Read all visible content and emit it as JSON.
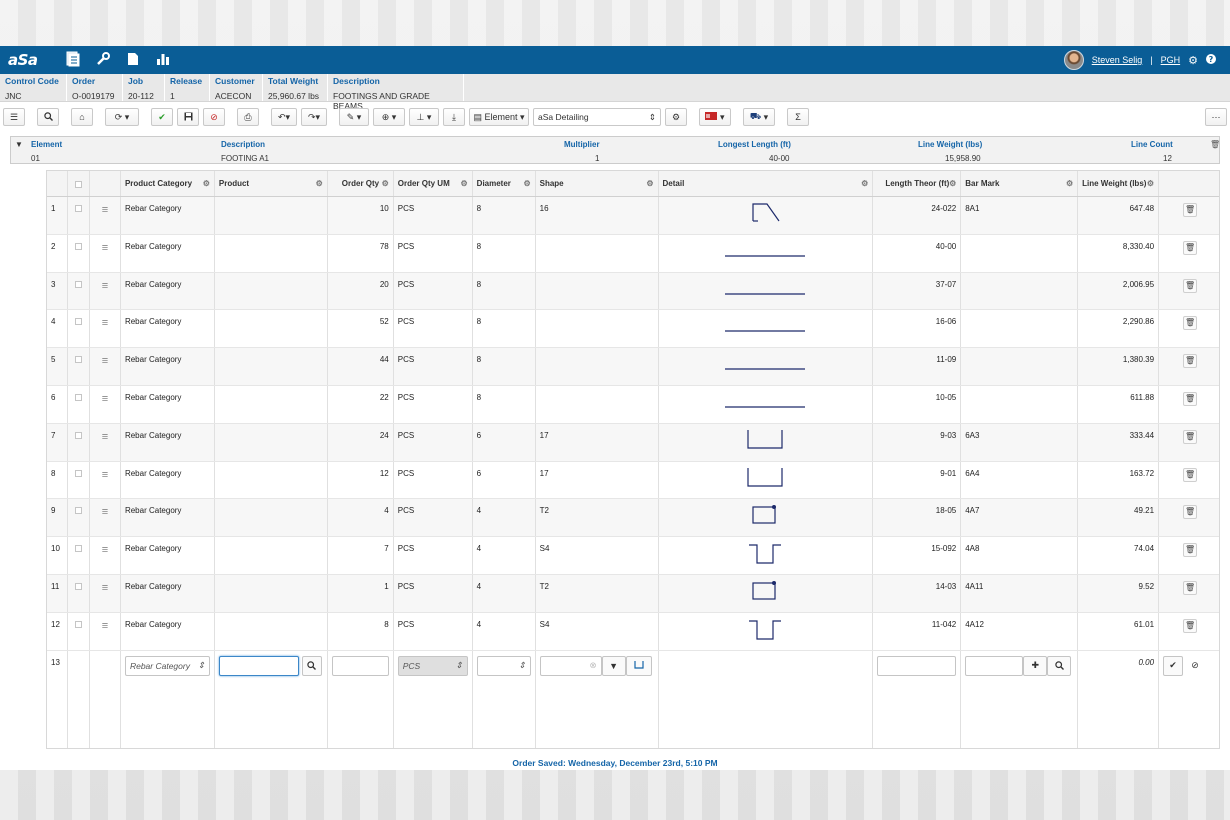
{
  "topbar": {
    "logo": "aSa",
    "user_name": "Steven Selig",
    "location": "PGH",
    "separator": "|"
  },
  "header": {
    "columns": [
      {
        "label": "Control Code",
        "value": "JNC"
      },
      {
        "label": "Order",
        "value": "O-0019179"
      },
      {
        "label": "Job",
        "value": "20-112"
      },
      {
        "label": "Release",
        "value": "1"
      },
      {
        "label": "Customer",
        "value": "ACECON"
      },
      {
        "label": "Total Weight",
        "value": "25,960.67 lbs"
      },
      {
        "label": "Description",
        "value": "FOOTINGS AND GRADE BEAMS"
      }
    ]
  },
  "toolbar": {
    "element_label": "Element",
    "detailing_select": "aSa Detailing",
    "sigma": "Σ"
  },
  "element": {
    "headers": {
      "element": "Element",
      "description": "Description",
      "multiplier": "Multiplier",
      "longest_length": "Longest Length (ft)",
      "line_weight": "Line Weight (lbs)",
      "line_count": "Line Count"
    },
    "values": {
      "element": "01",
      "description": "FOOTING A1",
      "multiplier": "1",
      "longest_length": "40-00",
      "line_weight": "15,958.90",
      "line_count": "12"
    }
  },
  "grid": {
    "columns": {
      "product_category": "Product Category",
      "product": "Product",
      "order_qty": "Order Qty",
      "order_qty_um": "Order Qty UM",
      "diameter": "Diameter",
      "shape": "Shape",
      "detail": "Detail",
      "length_theor": "Length Theor (ft)",
      "bar_mark": "Bar Mark",
      "line_weight": "Line Weight (lbs)"
    },
    "rows": [
      {
        "num": "1",
        "category": "Rebar Category",
        "product": "",
        "qty": "10",
        "um": "PCS",
        "dia": "8",
        "shape": "16",
        "detail": "hook",
        "length": "24-022",
        "mark": "8A1",
        "weight": "647.48"
      },
      {
        "num": "2",
        "category": "Rebar Category",
        "product": "",
        "qty": "78",
        "um": "PCS",
        "dia": "8",
        "shape": "",
        "detail": "straight",
        "length": "40-00",
        "mark": "",
        "weight": "8,330.40"
      },
      {
        "num": "3",
        "category": "Rebar Category",
        "product": "",
        "qty": "20",
        "um": "PCS",
        "dia": "8",
        "shape": "",
        "detail": "straight",
        "length": "37-07",
        "mark": "",
        "weight": "2,006.95"
      },
      {
        "num": "4",
        "category": "Rebar Category",
        "product": "",
        "qty": "52",
        "um": "PCS",
        "dia": "8",
        "shape": "",
        "detail": "straight",
        "length": "16-06",
        "mark": "",
        "weight": "2,290.86"
      },
      {
        "num": "5",
        "category": "Rebar Category",
        "product": "",
        "qty": "44",
        "um": "PCS",
        "dia": "8",
        "shape": "",
        "detail": "straight",
        "length": "11-09",
        "mark": "",
        "weight": "1,380.39"
      },
      {
        "num": "6",
        "category": "Rebar Category",
        "product": "",
        "qty": "22",
        "um": "PCS",
        "dia": "8",
        "shape": "",
        "detail": "straight",
        "length": "10-05",
        "mark": "",
        "weight": "611.88"
      },
      {
        "num": "7",
        "category": "Rebar Category",
        "product": "",
        "qty": "24",
        "um": "PCS",
        "dia": "6",
        "shape": "17",
        "detail": "u",
        "length": "9-03",
        "mark": "6A3",
        "weight": "333.44"
      },
      {
        "num": "8",
        "category": "Rebar Category",
        "product": "",
        "qty": "12",
        "um": "PCS",
        "dia": "6",
        "shape": "17",
        "detail": "u",
        "length": "9-01",
        "mark": "6A4",
        "weight": "163.72"
      },
      {
        "num": "9",
        "category": "Rebar Category",
        "product": "",
        "qty": "4",
        "um": "PCS",
        "dia": "4",
        "shape": "T2",
        "detail": "tie",
        "length": "18-05",
        "mark": "4A7",
        "weight": "49.21"
      },
      {
        "num": "10",
        "category": "Rebar Category",
        "product": "",
        "qty": "7",
        "um": "PCS",
        "dia": "4",
        "shape": "S4",
        "detail": "stirrup",
        "length": "15-092",
        "mark": "4A8",
        "weight": "74.04"
      },
      {
        "num": "11",
        "category": "Rebar Category",
        "product": "",
        "qty": "1",
        "um": "PCS",
        "dia": "4",
        "shape": "T2",
        "detail": "tie",
        "length": "14-03",
        "mark": "4A11",
        "weight": "9.52"
      },
      {
        "num": "12",
        "category": "Rebar Category",
        "product": "",
        "qty": "8",
        "um": "PCS",
        "dia": "4",
        "shape": "S4",
        "detail": "stirrup",
        "length": "11-042",
        "mark": "4A12",
        "weight": "61.01"
      }
    ],
    "new_row": {
      "num": "13",
      "category": "Rebar Category",
      "um": "PCS",
      "weight": "0.00"
    }
  },
  "footer": {
    "saved_text": "Order Saved: Wednesday, December 23rd, 5:10 PM"
  }
}
